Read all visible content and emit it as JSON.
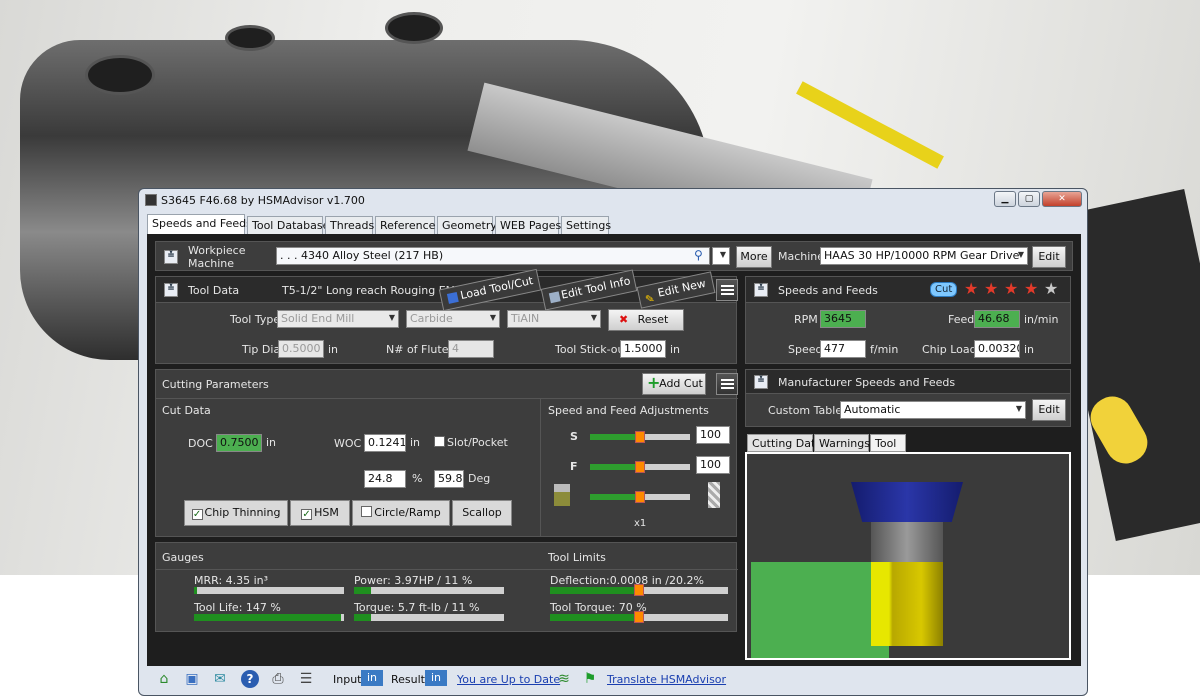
{
  "window": {
    "title": "S3645 F46.68 by HSMAdvisor v1.700"
  },
  "tabs": [
    "Speeds and Feeds",
    "Tool Database",
    "Threads",
    "Reference",
    "Geometry",
    "WEB Pages",
    "Settings"
  ],
  "workpiece": {
    "label1": "Workpiece",
    "label2": "Machine",
    "material": ". . . 4340 Alloy Steel (217 HB)",
    "more": "More",
    "machine_label": "Machine",
    "machine": "HAAS 30 HP/10000 RPM Gear Drive",
    "edit": "Edit"
  },
  "tooldata": {
    "title": "Tool Data",
    "tool_name": "T5-1/2\" Long reach Rouging EM",
    "load": "Load Tool/Cut",
    "edit_info": "Edit Tool Info",
    "edit_new": "Edit New",
    "tool_type_label": "Tool Type",
    "tool_type": "Solid End Mill",
    "material": "Carbide",
    "coating": "TiAlN",
    "reset": "Reset",
    "tip_dia_label": "Tip Dia",
    "tip_dia": "0.5000",
    "tip_unit": "in",
    "flutes_label": "N# of Flutes",
    "flutes": "4",
    "stickout_label": "Tool Stick-out",
    "stickout": "1.5000",
    "stickout_unit": "in"
  },
  "cutting": {
    "title": "Cutting Parameters",
    "add_cut": "Add Cut",
    "cut_data": "Cut Data",
    "doc_label": "DOC",
    "doc": "0.7500",
    "doc_unit": "in",
    "woc_label": "WOC",
    "woc": "0.1241",
    "woc_unit": "in",
    "slot": "Slot/Pocket",
    "pct": "24.8",
    "pct_unit": "%",
    "deg": "59.8",
    "deg_unit": "Deg",
    "chip": "Chip Thinning",
    "hsm": "HSM",
    "circle": "Circle/Ramp",
    "scallop": "Scallop",
    "adj_title": "Speed and Feed Adjustments",
    "s": "S",
    "f": "F",
    "s_val": "100",
    "f_val": "100",
    "x1": "x1",
    "s_pct": 0.5,
    "f_pct": 0.5,
    "third_pct": 0.5
  },
  "gauges": {
    "title": "Gauges",
    "mrr": "MRR: 4.35 in³",
    "mrr_pct": 0.02,
    "power": "Power: 3.97HP / 11 %",
    "power_pct": 0.11,
    "life": "Tool Life: 147 %",
    "life_pct": 0.98,
    "torque": "Torque: 5.7 ft-lb / 11 %",
    "torque_pct": 0.11
  },
  "limits": {
    "title": "Tool Limits",
    "deflection": "Deflection:0.0008 in /20.2%",
    "deflection_pct": 0.5,
    "torque": "Tool Torque: 70 %",
    "torque_pct": 0.5
  },
  "speeds": {
    "title": "Speeds and Feeds",
    "cut": "Cut",
    "rpm_label": "RPM",
    "rpm": "3645",
    "feed_label": "Feed",
    "feed": "46.68",
    "feed_unit": "in/min",
    "speed_label": "Speed",
    "speed": "477",
    "speed_unit": "f/min",
    "chip_label": "Chip Load",
    "chip": "0.00320",
    "chip_unit": "in",
    "stars": 4
  },
  "manufacturer": {
    "title": "Manufacturer Speeds and Feeds",
    "table_label": "Custom Table",
    "table": "Automatic",
    "edit": "Edit"
  },
  "viewtabs": [
    "Cutting Data",
    "Warnings",
    "Tool"
  ],
  "statusbar": {
    "input": "Input",
    "input_unit": "in",
    "result": "Result",
    "result_unit": "in",
    "uptodate": "You are Up to Date",
    "translate": "Translate HSMAdvisor"
  },
  "colors": {
    "accent_green": "#4caf50",
    "slider_thumb": "#ff8a00",
    "tool_shank": "#1f2a8c",
    "tool_flute": "#d8c800",
    "workpiece": "#4caf50"
  }
}
